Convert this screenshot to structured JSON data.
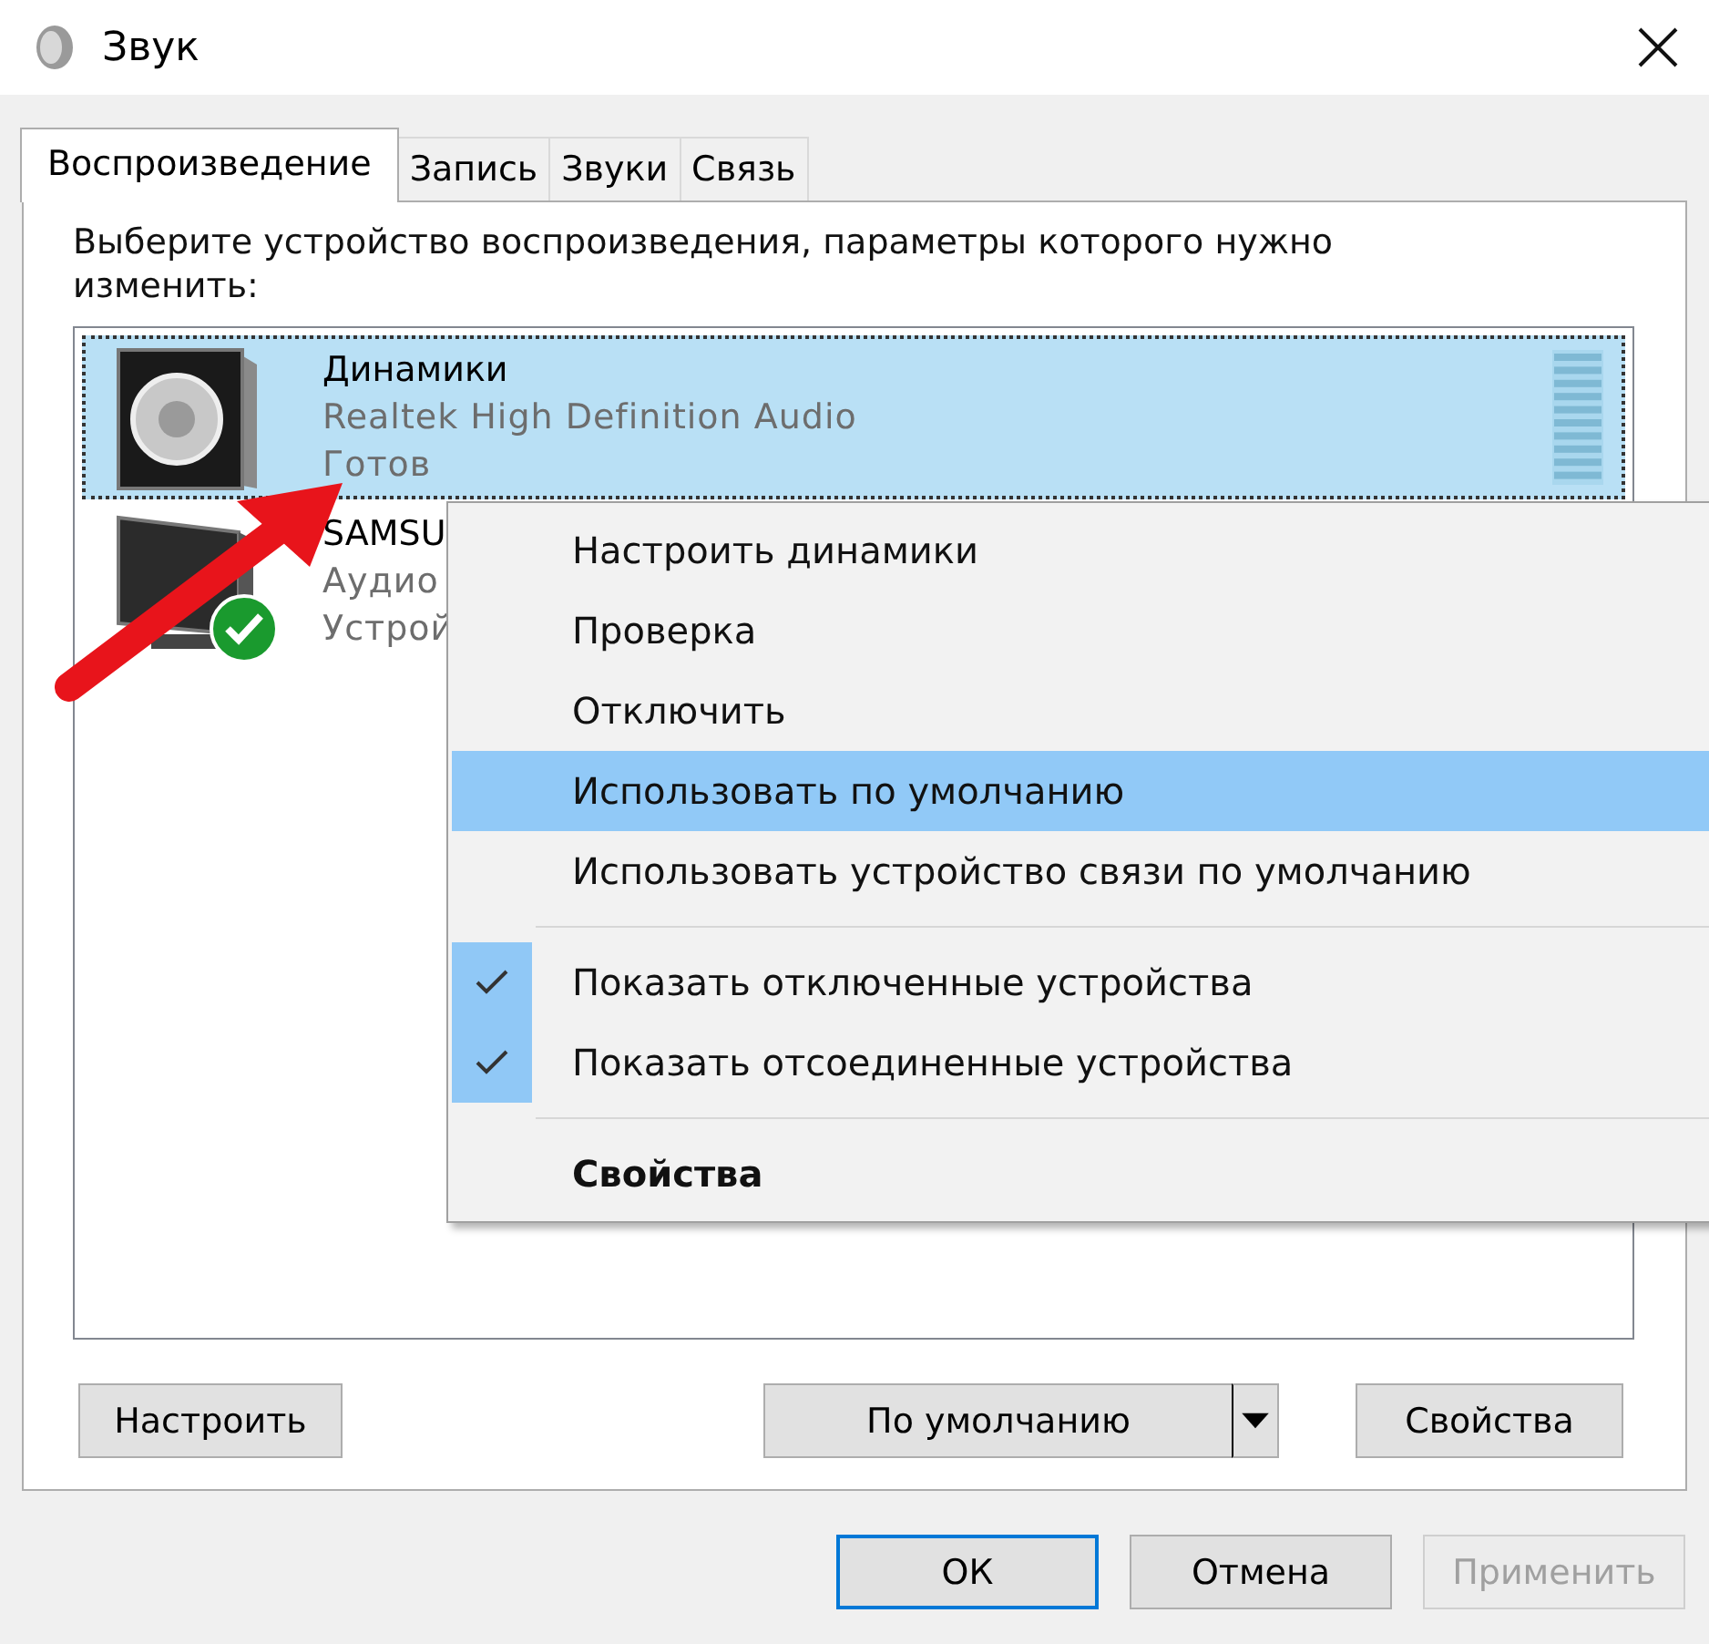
{
  "window": {
    "title": "Звук"
  },
  "tabs": [
    {
      "label": "Воспроизведение",
      "selected": true
    },
    {
      "label": "Запись",
      "selected": false
    },
    {
      "label": "Звуки",
      "selected": false
    },
    {
      "label": "Связь",
      "selected": false
    }
  ],
  "instruction": "Выберите устройство воспроизведения, параметры которого нужно изменить:",
  "devices": [
    {
      "kind": "speaker",
      "name": "Динамики",
      "driver": "Realtek High Definition Audio",
      "status": "Готов",
      "selected": true,
      "is_default": false
    },
    {
      "kind": "monitor",
      "name": "SAMSU",
      "driver": "Аудио",
      "status": "Устрой",
      "selected": false,
      "is_default": true
    }
  ],
  "context_menu": [
    {
      "kind": "item",
      "label": "Настроить динамики",
      "selected": false,
      "checked": false,
      "bold": false
    },
    {
      "kind": "item",
      "label": "Проверка",
      "selected": false,
      "checked": false,
      "bold": false
    },
    {
      "kind": "item",
      "label": "Отключить",
      "selected": false,
      "checked": false,
      "bold": false
    },
    {
      "kind": "item",
      "label": "Использовать по умолчанию",
      "selected": true,
      "checked": false,
      "bold": false
    },
    {
      "kind": "item",
      "label": "Использовать устройство связи по умолчанию",
      "selected": false,
      "checked": false,
      "bold": false
    },
    {
      "kind": "separator"
    },
    {
      "kind": "item",
      "label": "Показать отключенные устройства",
      "selected": false,
      "checked": true,
      "bold": false
    },
    {
      "kind": "item",
      "label": "Показать отсоединенные устройства",
      "selected": false,
      "checked": true,
      "bold": false
    },
    {
      "kind": "separator"
    },
    {
      "kind": "item",
      "label": "Свойства",
      "selected": false,
      "checked": false,
      "bold": true
    }
  ],
  "device_buttons": {
    "configure": "Настроить",
    "set_default": "По умолчанию",
    "properties": "Свойства"
  },
  "dialog_buttons": [
    {
      "label": "ОК",
      "default": true,
      "disabled": false
    },
    {
      "label": "Отмена",
      "default": false,
      "disabled": false
    },
    {
      "label": "Применить",
      "default": false,
      "disabled": true
    }
  ]
}
